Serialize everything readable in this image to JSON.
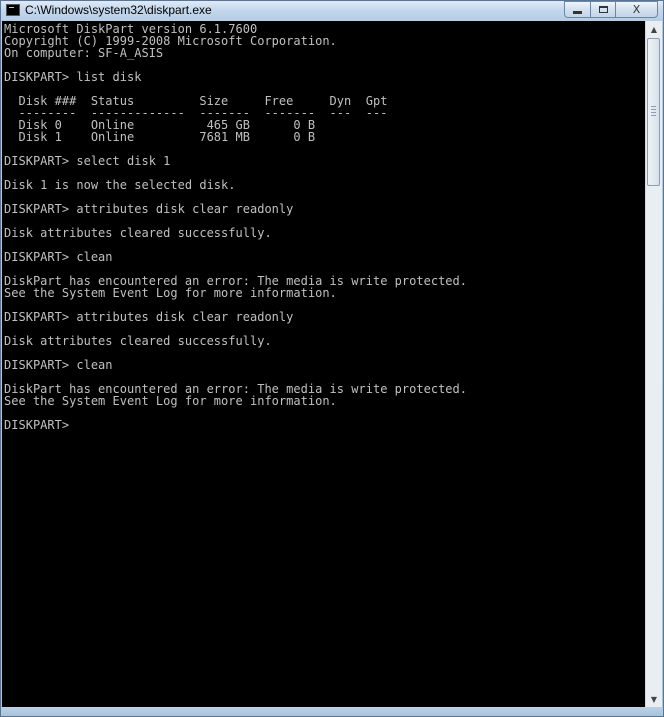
{
  "window": {
    "title": "C:\\Windows\\system32\\diskpart.exe",
    "icon": "console-app-icon",
    "buttons": {
      "minimize": "minimize",
      "maximize": "maximize",
      "close": "X"
    }
  },
  "console": {
    "lines": [
      "Microsoft DiskPart version 6.1.7600",
      "Copyright (C) 1999-2008 Microsoft Corporation.",
      "On computer: SF-A_ASIS",
      "",
      "DISKPART> list disk",
      "",
      "  Disk ###  Status         Size     Free     Dyn  Gpt",
      "  --------  -------------  -------  -------  ---  ---",
      "  Disk 0    Online          465 GB      0 B",
      "  Disk 1    Online         7681 MB      0 B",
      "",
      "DISKPART> select disk 1",
      "",
      "Disk 1 is now the selected disk.",
      "",
      "DISKPART> attributes disk clear readonly",
      "",
      "Disk attributes cleared successfully.",
      "",
      "DISKPART> clean",
      "",
      "DiskPart has encountered an error: The media is write protected.",
      "See the System Event Log for more information.",
      "",
      "DISKPART> attributes disk clear readonly",
      "",
      "Disk attributes cleared successfully.",
      "",
      "DISKPART> clean",
      "",
      "DiskPart has encountered an error: The media is write protected.",
      "See the System Event Log for more information.",
      "",
      "DISKPART>"
    ],
    "text_color": "#c0c0c0",
    "background_color": "#000000"
  },
  "scrollbar": {
    "up_arrow": "▲",
    "down_arrow": "▼"
  }
}
